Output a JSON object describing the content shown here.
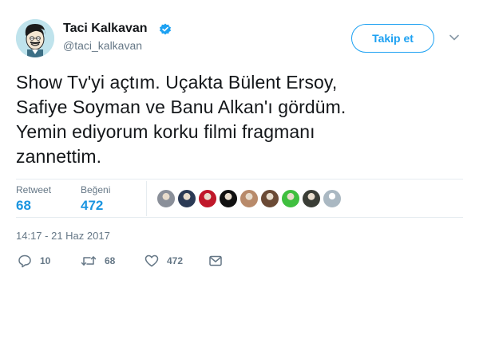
{
  "user": {
    "display_name": "Taci Kalkavan",
    "handle": "@taci_kalkavan",
    "avatar_icon": "cartoon-face-avatar",
    "verified_icon": "verified-badge-icon"
  },
  "follow_button": {
    "label": "Takip et"
  },
  "tweet": {
    "lines": [
      "Show Tv'yi açtım. Uçakta Bülent Ersoy,",
      "Safiye Soyman ve Banu Alkan'ı gördüm.",
      "Yemin ediyorum korku filmi fragmanı",
      "zannettim."
    ],
    "timestamp": "14:17 - 21 Haz 2017"
  },
  "stats": {
    "retweet_label": "Retweet",
    "retweet_count": "68",
    "like_label": "Beğeni",
    "like_count": "472"
  },
  "likers": [
    {
      "color": "#8a8f99"
    },
    {
      "color": "#2b3a55"
    },
    {
      "color": "#c0182a"
    },
    {
      "color": "#111111"
    },
    {
      "color": "#b88a6a"
    },
    {
      "color": "#6b4a35"
    },
    {
      "color": "#3fbf3f"
    },
    {
      "color": "#3a3d36"
    },
    {
      "color": "#aab8c2"
    }
  ],
  "actions": {
    "reply_count": "10",
    "retweet_count": "68",
    "like_count": "472"
  },
  "colors": {
    "accent": "#1da1f2",
    "stat_value": "#1b95e0",
    "muted": "#657786"
  }
}
